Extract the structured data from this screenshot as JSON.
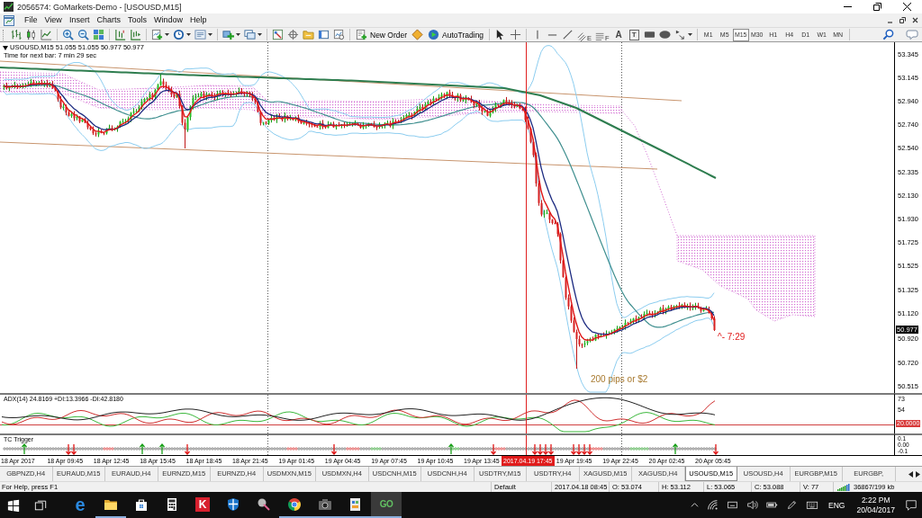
{
  "window": {
    "title": "2056574: GoMarkets-Demo - [USOUSD,M15]"
  },
  "menu": [
    "File",
    "View",
    "Insert",
    "Charts",
    "Tools",
    "Window",
    "Help"
  ],
  "toolbar": {
    "buttons": [
      "New Order",
      "AutoTrading"
    ],
    "tool_letters": [
      "E",
      "F",
      "A",
      "T"
    ],
    "periods": [
      {
        "label": "M1",
        "selected": false
      },
      {
        "label": "M5",
        "selected": false
      },
      {
        "label": "M15",
        "selected": true
      },
      {
        "label": "M30",
        "selected": false
      },
      {
        "label": "H1",
        "selected": false
      },
      {
        "label": "H4",
        "selected": false
      },
      {
        "label": "D1",
        "selected": false
      },
      {
        "label": "W1",
        "selected": false
      },
      {
        "label": "MN",
        "selected": false
      }
    ]
  },
  "chart": {
    "quote_line": "USOUSD,M15 51.055 51.055 50.977 50.977",
    "timer": "Time for next bar: 7 min 29 sec",
    "price_axis": [
      "53.345",
      "53.145",
      "52.940",
      "52.740",
      "52.540",
      "52.335",
      "52.130",
      "51.930",
      "51.725",
      "51.525",
      "51.325",
      "51.120",
      "50.920",
      "50.720",
      "50.515"
    ],
    "current_price": "50.977",
    "annotations": [
      {
        "kind": "countdown",
        "text": "^- 7:29"
      },
      {
        "kind": "note",
        "text": "200 pips or $2"
      }
    ],
    "adx": {
      "label": "ADX(14) 24.8169 +DI:13.3966 -DI:42.8180",
      "axis": [
        "73",
        "54"
      ],
      "level_label": "20.0000"
    },
    "trigger": {
      "label": "TC Trigger",
      "axis": [
        "0.1",
        "0.00",
        "-0.1"
      ]
    },
    "time_axis": [
      {
        "kind": "tick",
        "text": "18 Apr 2017"
      },
      {
        "kind": "tick",
        "text": "18 Apr 09:45"
      },
      {
        "kind": "tick",
        "text": "18 Apr 12:45"
      },
      {
        "kind": "tick",
        "text": "18 Apr 15:45"
      },
      {
        "kind": "tick",
        "text": "18 Apr 18:45"
      },
      {
        "kind": "tick",
        "text": "18 Apr 21:45"
      },
      {
        "kind": "tick",
        "text": "19 Apr 01:45"
      },
      {
        "kind": "tick",
        "text": "19 Apr 04:45"
      },
      {
        "kind": "tick",
        "text": "19 Apr 07:45"
      },
      {
        "kind": "tick",
        "text": "19 Apr 10:45"
      },
      {
        "kind": "tick",
        "text": "19 Apr 13:45"
      },
      {
        "kind": "cursor",
        "text": "2017.04.19 17:45"
      },
      {
        "kind": "tick",
        "text": "19 Apr 19:45"
      },
      {
        "kind": "tick",
        "text": "19 Apr 22:45"
      },
      {
        "kind": "tick",
        "text": "20 Apr 02:45"
      },
      {
        "kind": "tick",
        "text": "20 Apr 05:45"
      }
    ]
  },
  "tabs": [
    {
      "label": "GBPNZD,H4",
      "selected": false
    },
    {
      "label": "EURAUD,M15",
      "selected": false
    },
    {
      "label": "EURAUD,H4",
      "selected": false
    },
    {
      "label": "EURNZD,M15",
      "selected": false
    },
    {
      "label": "EURNZD,H4",
      "selected": false
    },
    {
      "label": "USDMXN,M15",
      "selected": false
    },
    {
      "label": "USDMXN,H4",
      "selected": false
    },
    {
      "label": "USDCNH,M15",
      "selected": false
    },
    {
      "label": "USDCNH,H4",
      "selected": false
    },
    {
      "label": "USDTRY,M15",
      "selected": false
    },
    {
      "label": "USDTRY,H4",
      "selected": false
    },
    {
      "label": "XAGUSD,M15",
      "selected": false
    },
    {
      "label": "XAGUSD,H4",
      "selected": false
    },
    {
      "label": "USOUSD,M15",
      "selected": true
    },
    {
      "label": "USOUSD,H4",
      "selected": false
    },
    {
      "label": "EURGBP,M15",
      "selected": false
    },
    {
      "label": "EURGBP,",
      "selected": false
    }
  ],
  "status_bar": {
    "help": "For Help, press F1",
    "profile": "Default",
    "time": "2017.04.18 08:45",
    "open": "O: 53.074",
    "high": "H: 53.112",
    "low": "L: 53.065",
    "close": "C: 53.088",
    "volume": "V: 77",
    "traffic": "36867/199 kb"
  },
  "taskbar": {
    "apps": [
      {
        "kind": "edge",
        "letter": "e",
        "running": false,
        "selected": false
      },
      {
        "kind": "explorer",
        "running": true,
        "selected": false
      },
      {
        "kind": "store",
        "running": false,
        "selected": false
      },
      {
        "kind": "calculator",
        "running": false,
        "selected": false
      },
      {
        "kind": "tile",
        "letter": "K",
        "running": false,
        "selected": false
      },
      {
        "kind": "shield",
        "running": false,
        "selected": false
      },
      {
        "kind": "pin",
        "running": false,
        "selected": false
      },
      {
        "kind": "ring",
        "running": true,
        "selected": false
      },
      {
        "kind": "camera",
        "running": true,
        "selected": false
      },
      {
        "kind": "document",
        "running": true,
        "selected": false
      },
      {
        "kind": "outline",
        "letter": "GO",
        "running": true,
        "selected": true
      }
    ],
    "language": "ENG",
    "time": "2:22 PM",
    "date": "20/04/2017"
  }
}
